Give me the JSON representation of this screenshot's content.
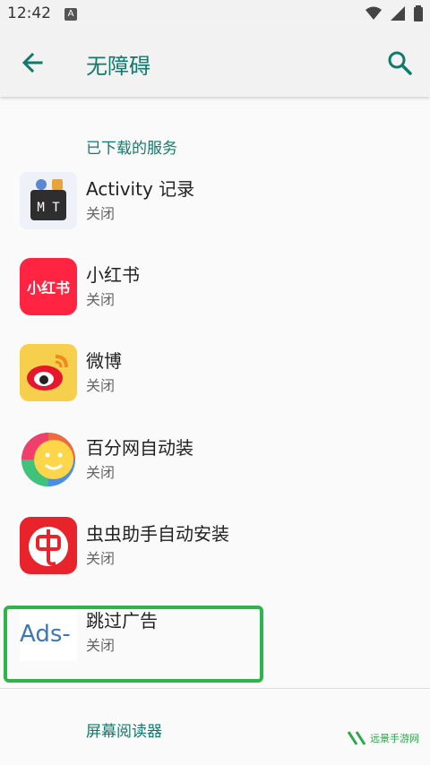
{
  "status_bar": {
    "time": "12:42",
    "notif_letter": "A"
  },
  "app_bar": {
    "title": "无障碍"
  },
  "sections": {
    "downloaded": "已下载的服务",
    "screen_reader": "屏幕阅读器"
  },
  "services": [
    {
      "title": "Activity 记录",
      "status": "关闭",
      "icon": "mt-icon",
      "icon_text": "M T"
    },
    {
      "title": "小红书",
      "status": "关闭",
      "icon": "xiaohongshu-icon",
      "icon_text": "小红书"
    },
    {
      "title": "微博",
      "status": "关闭",
      "icon": "weibo-icon"
    },
    {
      "title": "百分网自动装",
      "status": "关闭",
      "icon": "baifen-icon"
    },
    {
      "title": "虫虫助手自动安装",
      "status": "关闭",
      "icon": "chongchong-icon"
    },
    {
      "title": "跳过广告",
      "status": "关闭",
      "icon": "ads-icon",
      "icon_text": "Ads-"
    }
  ],
  "watermark": "远景手游网",
  "colors": {
    "accent": "#127a6c",
    "highlight": "#2fb34a"
  }
}
